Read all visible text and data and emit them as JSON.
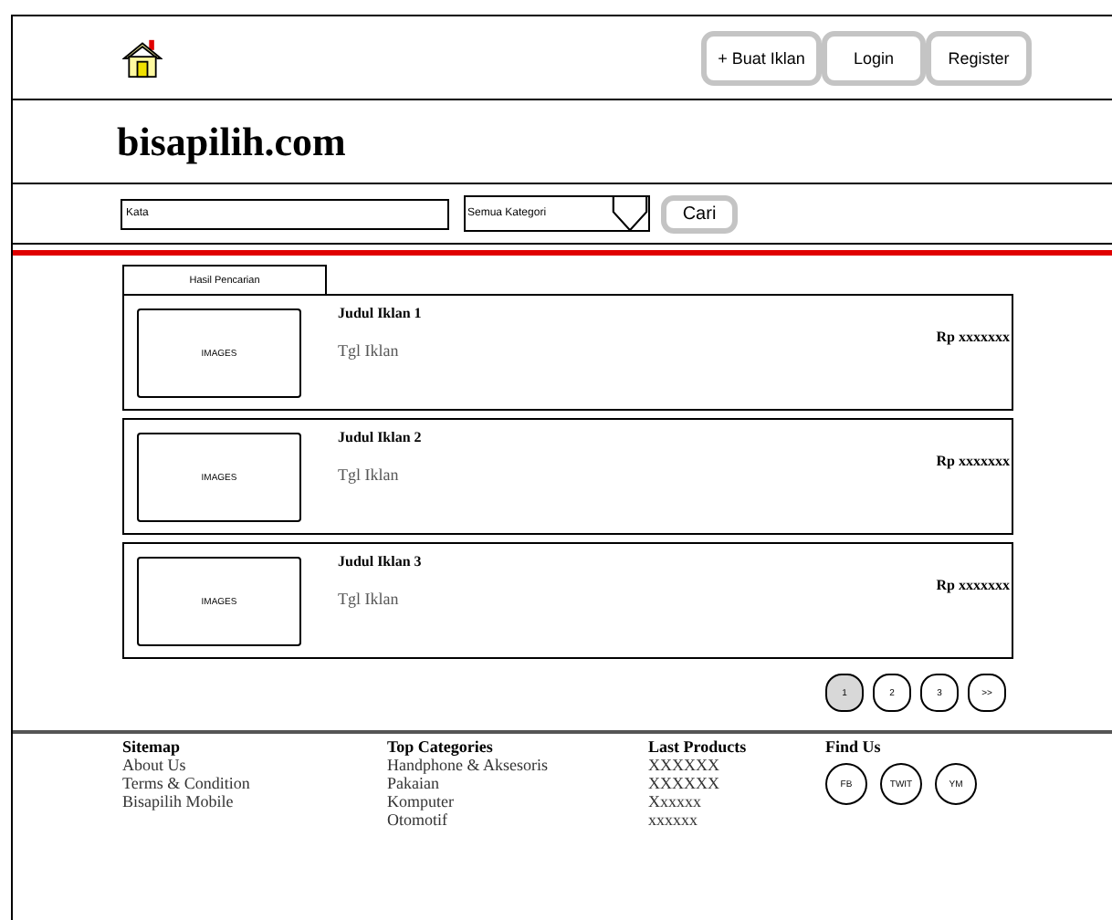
{
  "header": {
    "buttons": [
      "+ Buat Iklan",
      "Login",
      "Register"
    ]
  },
  "logo": "bisapilih.com",
  "search": {
    "placeholder": "Kata",
    "category": "Semua Kategori",
    "button": "Cari"
  },
  "results_tab": "Hasil Pencarian",
  "listings": [
    {
      "image_label": "IMAGES",
      "title": "Judul Iklan 1",
      "date": "Tgl Iklan",
      "price": "Rp xxxxxxx"
    },
    {
      "image_label": "IMAGES",
      "title": "Judul Iklan 2",
      "date": "Tgl Iklan",
      "price": "Rp xxxxxxx"
    },
    {
      "image_label": "IMAGES",
      "title": "Judul Iklan 3",
      "date": "Tgl Iklan",
      "price": "Rp xxxxxxx"
    }
  ],
  "pagination": [
    {
      "label": "1",
      "selected": true
    },
    {
      "label": "2",
      "selected": false
    },
    {
      "label": "3",
      "selected": false
    },
    {
      "label": ">>",
      "selected": false
    }
  ],
  "footer": [
    {
      "kind": "links",
      "heading": "Sitemap",
      "items": [
        "About Us",
        "Terms & Condition",
        "Bisapilih Mobile"
      ]
    },
    {
      "kind": "links",
      "heading": "Top Categories",
      "items": [
        "Handphone & Aksesoris",
        "Pakaian",
        "Komputer",
        "Otomotif"
      ]
    },
    {
      "kind": "links",
      "heading": "Last Products",
      "items": [
        "XXXXXX",
        "XXXXXX",
        "Xxxxxx",
        "xxxxxx"
      ]
    },
    {
      "kind": "social",
      "heading": "Find Us",
      "items": [
        "FB",
        "TWIT",
        "YM"
      ]
    }
  ]
}
